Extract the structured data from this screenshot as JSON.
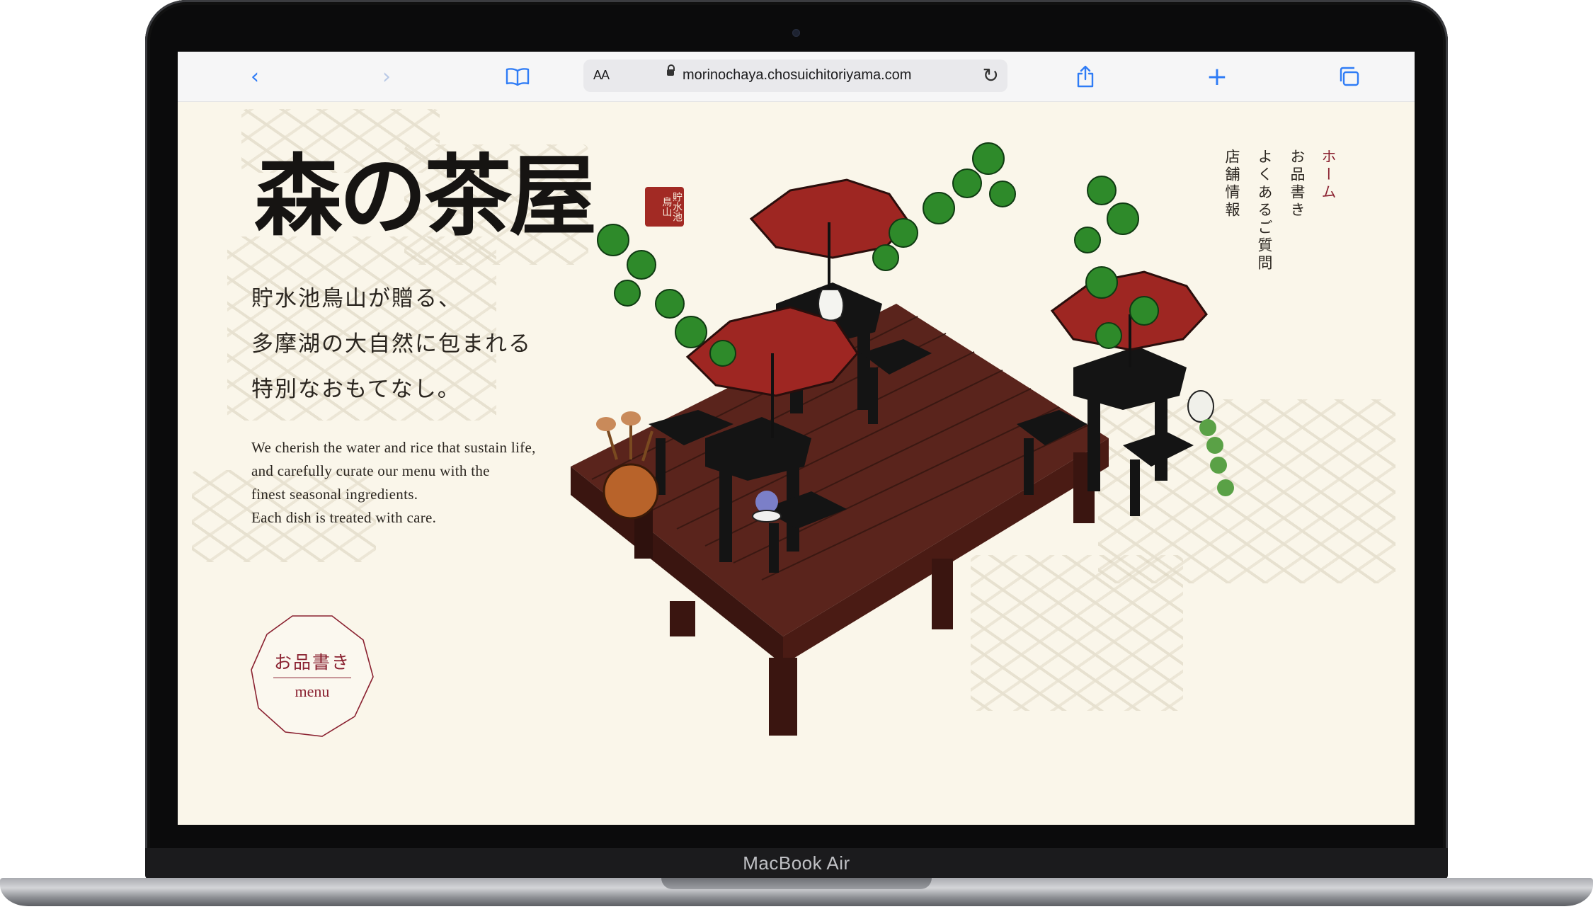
{
  "device": {
    "brand": "MacBook Air"
  },
  "browser": {
    "aa_label": "AA",
    "url": "morinochaya.chosuichitoriyama.com",
    "icons": [
      "back-icon",
      "forward-icon",
      "bookmarks-icon",
      "lock-icon",
      "reload-icon",
      "share-icon",
      "new-tab-icon",
      "tabs-icon"
    ]
  },
  "site": {
    "logo": "森の茶屋",
    "seal": "貯水池鳥山",
    "tagline": [
      "貯水池鳥山が贈る、",
      "多摩湖の大自然に包まれる",
      "特別なおもてなし。"
    ],
    "english": [
      "We cherish the water and rice that sustain life,",
      "and carefully curate our menu with the",
      "finest seasonal ingredients.",
      "Each dish is treated with care."
    ],
    "menu_button": {
      "jp": "お品書き",
      "en": "menu"
    },
    "nav": [
      "ホーム",
      "お品書き",
      "よくあるご質問",
      "店舗情報"
    ],
    "colors": {
      "accent": "#8a2130",
      "background": "#faf6ea",
      "umbrella": "#9e2622",
      "deck": "#5a241c"
    }
  }
}
